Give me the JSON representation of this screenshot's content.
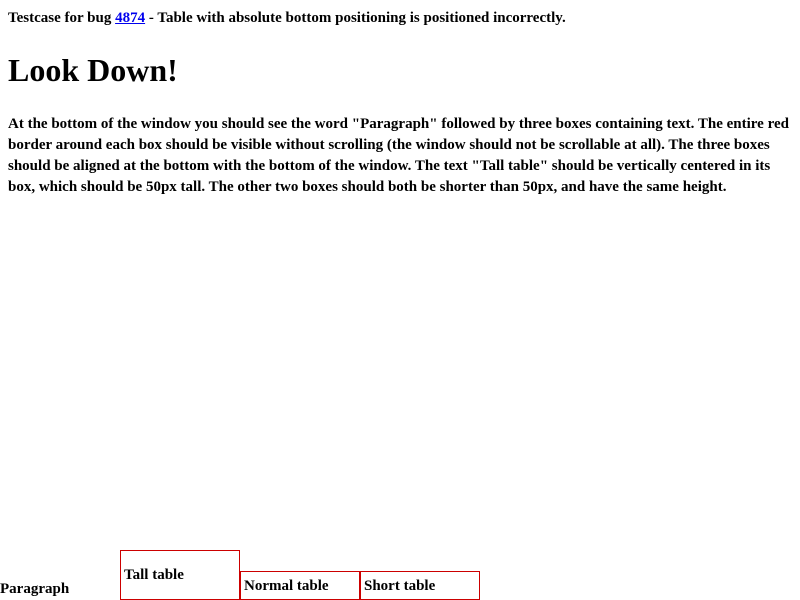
{
  "intro": {
    "prefix": "Testcase for bug ",
    "bug_link": "4874",
    "suffix": " - Table with absolute bottom positioning is positioned incorrectly."
  },
  "heading": "Look Down!",
  "description": "At the bottom of the window you should see the word \"Paragraph\" followed by three boxes containing text. The entire red border around each box should be visible without scrolling (the window should not be scrollable at all). The three boxes should be aligned at the bottom with the bottom of the window. The text \"Tall table\" should be vertically centered in its box, which should be 50px tall. The other two boxes should both be shorter than 50px, and have the same height.",
  "bottom": {
    "paragraph_label": "Paragraph",
    "tall_table": "Tall table",
    "normal_table": "Normal table",
    "short_table": "Short table"
  },
  "colors": {
    "link": "#0000ee",
    "border": "#cc0000",
    "text": "#000000",
    "background": "#ffffff"
  }
}
